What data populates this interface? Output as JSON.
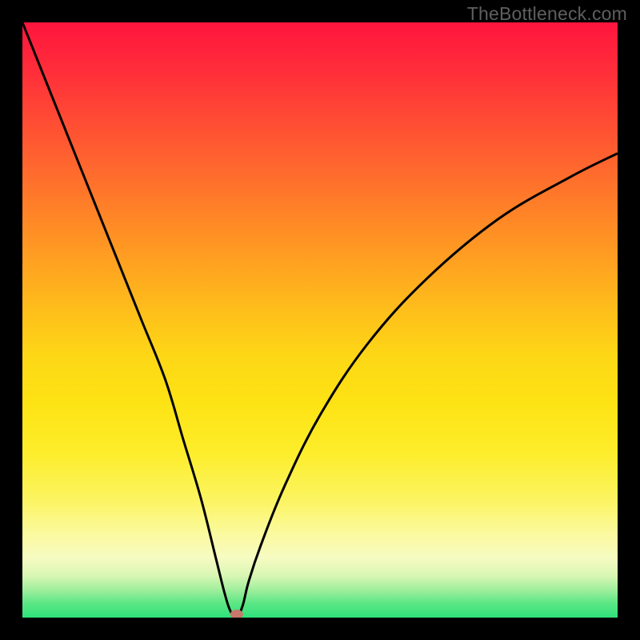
{
  "watermark": "TheBottleneck.com",
  "colors": {
    "frame_bg": "#000000",
    "gradient_top": "#ff153e",
    "gradient_mid": "#fde314",
    "gradient_optimal_band": "#fbfcc7",
    "gradient_bottom": "#2de27a",
    "curve_stroke": "#000000",
    "marker_fill": "#c7776c",
    "watermark_text": "#5f5f5f"
  },
  "chart_data": {
    "type": "line",
    "title": "",
    "xlabel": "",
    "ylabel": "",
    "xlim": [
      0,
      100
    ],
    "ylim": [
      0,
      100
    ],
    "series": [
      {
        "name": "bottleneck-curve",
        "x": [
          0,
          4,
          8,
          12,
          16,
          20,
          24,
          27,
          30,
          32.5,
          34,
          35,
          36,
          37,
          38,
          40,
          44,
          50,
          58,
          68,
          80,
          92,
          100
        ],
        "y": [
          100,
          90,
          80,
          70,
          60,
          50,
          40,
          30,
          20,
          10,
          4,
          1,
          0,
          2,
          6,
          12,
          22,
          34,
          46,
          57,
          67,
          74,
          78
        ]
      }
    ],
    "marker": {
      "x": 36,
      "y": 0
    },
    "gradient_stops": [
      {
        "pos": 0.0,
        "meaning": "worst",
        "color": "#ff153e"
      },
      {
        "pos": 0.5,
        "meaning": "mid",
        "color": "#fde314"
      },
      {
        "pos": 0.9,
        "meaning": "good",
        "color": "#fbfcc7"
      },
      {
        "pos": 1.0,
        "meaning": "optimal",
        "color": "#2de27a"
      }
    ]
  }
}
